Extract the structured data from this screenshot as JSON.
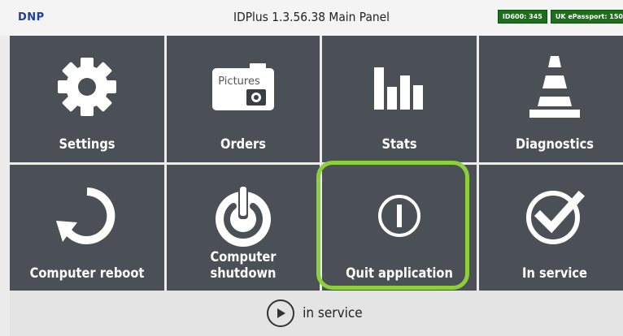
{
  "header": {
    "brand": "DNP",
    "title": "IDPlus 1.3.56.38 Main Panel",
    "badges": [
      "ID600: 345",
      "UK ePassport: 150"
    ]
  },
  "tiles": [
    {
      "label": "Settings",
      "icon": "gear-icon"
    },
    {
      "label": "Orders",
      "icon": "pictures-camera-icon",
      "icon_text": "Pictures"
    },
    {
      "label": "Stats",
      "icon": "bar-chart-icon"
    },
    {
      "label": "Diagnostics",
      "icon": "traffic-cone-icon"
    },
    {
      "label": "Computer reboot",
      "icon": "reboot-icon"
    },
    {
      "label": "Computer shutdown",
      "icon": "power-icon"
    },
    {
      "label": "Quit application",
      "icon": "quit-icon"
    },
    {
      "label": "In service",
      "icon": "checkmark-circle-icon"
    }
  ],
  "footer": {
    "label": "in service",
    "icon": "play-icon"
  },
  "colors": {
    "tile_bg": "#4a5055",
    "highlight": "#8dd03a",
    "badge_bg": "#1e6e1e",
    "brand": "#1f3f9a"
  }
}
